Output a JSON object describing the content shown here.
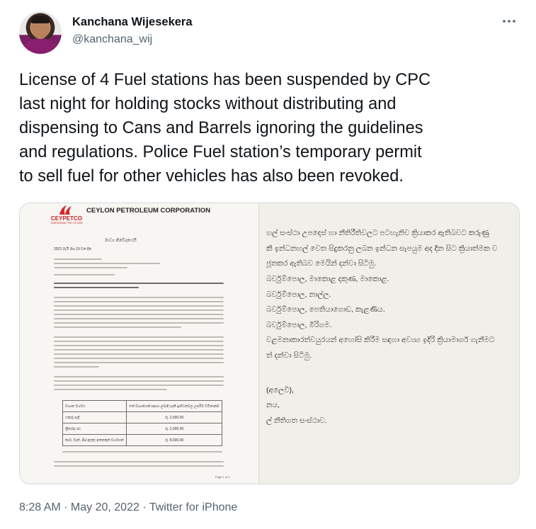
{
  "author": {
    "display_name": "Kanchana Wijesekera",
    "handle": "@kanchana_wij"
  },
  "more_icon": "more-horizontal-icon",
  "tweet": {
    "lines": [
      "License of 4 Fuel stations has been suspended by CPC",
      "last night for holding stocks without distributing and",
      "dispensing to Cans and Barrels ignoring the guidelines",
      "and regulations. Police Fuel station’s temporary permit",
      "to sell fuel for other vehicles has also been revoked."
    ]
  },
  "media": {
    "logo_text": "CEYPETCO",
    "logo_tagline": "ENERGIZING THE FUTURE",
    "corporation_name": "CEYLON PETROLEUM CORPORATION",
    "doc_title": "මාධ්‍ය නිවේදනයයි",
    "doc_date": "2022 මැයි මස 19 වන දින",
    "table": {
      "header": [
        "වාහන වර්ගය",
        "එක් වාහනයක් සඳහා ලබාදී හැකි ඉන්ධනවල උපරිම වටිනාකම"
      ],
      "rows": [
        [
          "යතුරු පැදි",
          "රු. 2,000.00"
        ],
        [
          "ත්‍රීරෝද රථ",
          "රු. 2,000.00"
        ],
        [
          "කාර්, වෑන්, ජීප් ඇතුළු අනෙකුත් වර්ගයන්",
          "රු. 8,000.00"
        ]
      ]
    },
    "page_number": "Page 1 of 2",
    "right_page_lines": [
      "හල් සංස්ථා උපදෙස් හා නීතිරීතිවලට පටහැනිව ක්‍රියාකර ඇතිබවට කරුණු",
      "කී ඉන්ධනහල් වෙත සිදුකරනු ලබන ඉන්ධන සැපයුම අද දින සිට ක්‍රියාත්මක ව",
      "ජූතකර ඇතිබව මෙයින් දන්වා සිටිමු.",
      "බර්වුම්පොල, මාකොළ දකුණ, මාකොළ.",
      "බර්වුම්පොල, නාල්ල.",
      "බර්වුම්පොල, පෙතියාගොඩ, කැළණිය.",
      "බර්වුම්පොල, මීරිගම.",
      "වළමනාකාරත්වයුරයන් අහෝසි කිරීම සඳහා අවශ්‍ය ඉදිරි ක්‍රියාමාර්ග ගැනීමට",
      "ත් දන්වා සිටිමු.",
      "(අලෙවි),",
      "නය,",
      "ල් නීතිගත සංස්ථාව."
    ]
  },
  "footer": {
    "timestamp": "8:28 AM · May 20, 2022",
    "separator": " · ",
    "source": "Twitter for iPhone"
  }
}
